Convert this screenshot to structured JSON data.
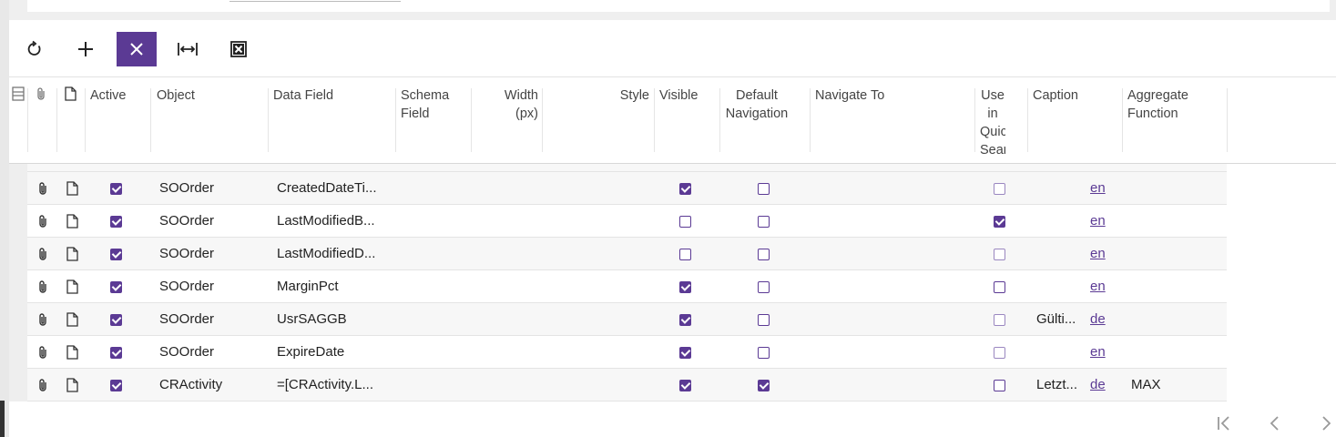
{
  "toolbar": {
    "buttons": [
      {
        "name": "refresh-button",
        "icon": "refresh-icon"
      },
      {
        "name": "add-row-button",
        "icon": "plus-icon"
      },
      {
        "name": "delete-row-button",
        "icon": "close-icon",
        "active": true
      },
      {
        "name": "fit-columns-button",
        "icon": "fit-width-icon"
      },
      {
        "name": "export-excel-button",
        "icon": "excel-icon"
      }
    ]
  },
  "grid": {
    "headers": {
      "active": "Active",
      "object": "Object",
      "data_field": "Data Field",
      "schema_field_1": "Schema",
      "schema_field_2": "Field",
      "width_1": "Width",
      "width_2": "(px)",
      "style": "Style",
      "visible": "Visible",
      "default_nav_1": "Default",
      "default_nav_2": "Navigation",
      "navigate_to": "Navigate To",
      "quick_search_1": "Use",
      "quick_search_2": "in",
      "quick_search_3": "Quick",
      "quick_search_4": "Search",
      "caption": "Caption",
      "aggregate_1": "Aggregate",
      "aggregate_2": "Function"
    },
    "rows": [
      {
        "active": true,
        "object": "SOOrder",
        "data_field": "CreatedDateTi...",
        "visible": true,
        "default_nav": false,
        "quick_search": false,
        "quick_search_disabled": true,
        "caption": "",
        "lang": "en",
        "aggregate": ""
      },
      {
        "active": true,
        "object": "SOOrder",
        "data_field": "LastModifiedB...",
        "visible": false,
        "default_nav": false,
        "quick_search": true,
        "quick_search_disabled": true,
        "caption": "",
        "lang": "en",
        "aggregate": ""
      },
      {
        "active": true,
        "object": "SOOrder",
        "data_field": "LastModifiedD...",
        "visible": false,
        "default_nav": false,
        "quick_search": false,
        "quick_search_disabled": true,
        "caption": "",
        "lang": "en",
        "aggregate": ""
      },
      {
        "active": true,
        "object": "SOOrder",
        "data_field": "MarginPct",
        "visible": true,
        "default_nav": false,
        "quick_search": false,
        "quick_search_disabled": false,
        "caption": "",
        "lang": "en",
        "aggregate": ""
      },
      {
        "active": true,
        "object": "SOOrder",
        "data_field": "UsrSAGGB",
        "visible": true,
        "default_nav": false,
        "quick_search": false,
        "quick_search_disabled": true,
        "caption": "Gülti...",
        "lang": "de",
        "aggregate": ""
      },
      {
        "active": true,
        "object": "SOOrder",
        "data_field": "ExpireDate",
        "visible": true,
        "default_nav": false,
        "quick_search": false,
        "quick_search_disabled": true,
        "caption": "",
        "lang": "en",
        "aggregate": ""
      },
      {
        "active": true,
        "object": "CRActivity",
        "data_field": "=[CRActivity.L...",
        "visible": true,
        "default_nav": true,
        "quick_search": false,
        "quick_search_disabled": false,
        "caption": "Letzt...",
        "lang": "de",
        "aggregate": "MAX"
      }
    ]
  },
  "pager": {
    "buttons": [
      {
        "name": "first-page-button",
        "icon": "first-page-icon"
      },
      {
        "name": "prev-page-button",
        "icon": "chevron-left-icon"
      },
      {
        "name": "next-page-button",
        "icon": "chevron-right-icon"
      }
    ]
  },
  "colors": {
    "accent": "#5b3a94",
    "row_alt": "#f7f7f7"
  }
}
